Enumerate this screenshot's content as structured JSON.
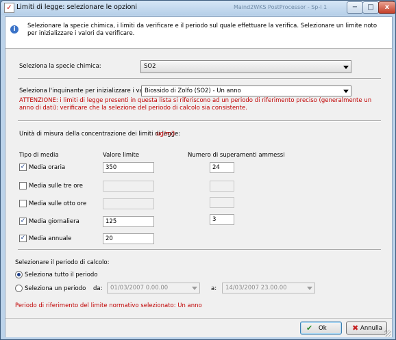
{
  "window": {
    "title": "Limiti di legge: selezionare le opzioni",
    "background_title": "Maind2WKS PostProcessor - Sp-l 1",
    "controls": {
      "minimize": "−",
      "maximize": "□",
      "close": "x"
    }
  },
  "header": {
    "description": "Selezionare la specie chimica, i limiti da verificare e il periodo sul quale effettuare la verifica. Selezionare un limite noto per inizializzare i valori da verificare."
  },
  "species": {
    "label": "Seleziona la specie chimica:",
    "selected": "SO2"
  },
  "pollutant": {
    "label": "Seleziona l'inquinante per inizializzare i valori:",
    "selected": "Biossido di Zolfo (SO2) - Un anno",
    "warning": "ATTENZIONE: i limiti di legge presenti in questa lista si riferiscono ad un periodo di riferimento preciso (generalmente un anno di dati): verificare che la selezione del periodo di calcolo sia consistente."
  },
  "units": {
    "label": "Unità di misura della concentrazione dei limiti di legge:",
    "value": "ug/m3"
  },
  "limits_table": {
    "headers": [
      "Tipo di media",
      "Valore limite",
      "Numero di superamenti ammessi"
    ],
    "rows": [
      {
        "label": "Media oraria",
        "checked": true,
        "limit": "350",
        "exceedances": "24"
      },
      {
        "label": "Media sulle tre ore",
        "checked": false,
        "limit": "",
        "exceedances": ""
      },
      {
        "label": "Media sulle otto ore",
        "checked": false,
        "limit": "",
        "exceedances": ""
      },
      {
        "label": "Media giornaliera",
        "checked": true,
        "limit": "125",
        "exceedances": "3"
      },
      {
        "label": "Media annuale",
        "checked": true,
        "limit": "20",
        "exceedances": null
      }
    ]
  },
  "period": {
    "label": "Selezionare il periodo di calcolo:",
    "option_all": "Seleziona tutto il periodo",
    "option_range": "Seleziona un periodo",
    "selected": "all",
    "from_label": "da:",
    "from_value": "01/03/2007 0.00.00",
    "to_label": "a:",
    "to_value": "14/03/2007 23.00.00",
    "reference_note": "Periodo di riferimento del limite normativo selezionato: Un anno"
  },
  "buttons": {
    "ok": "Ok",
    "cancel": "Annulla"
  },
  "icons": {
    "title": "app-check-icon",
    "info": "info-icon",
    "ok": "checkmark-icon",
    "cancel": "x-icon"
  },
  "colors": {
    "warning_text": "#c00000",
    "window_frame": "#bcd3ea",
    "dialog_bg": "#f0f0f0"
  }
}
